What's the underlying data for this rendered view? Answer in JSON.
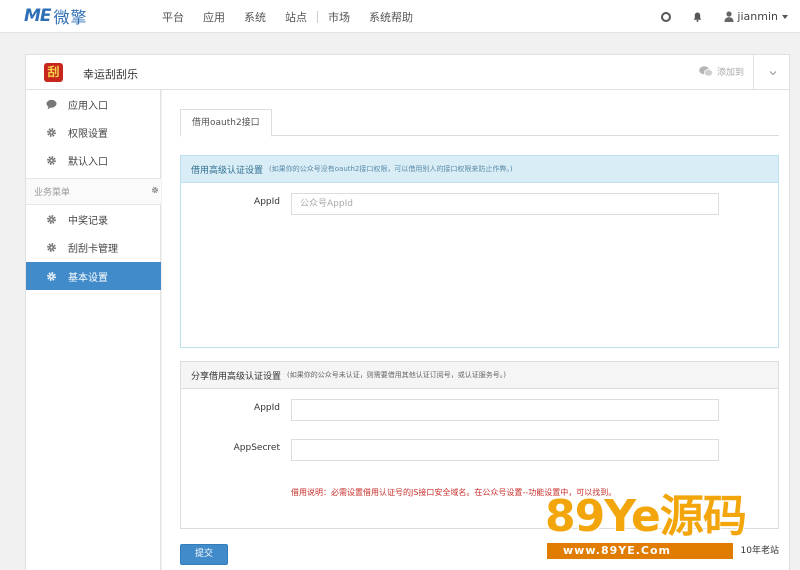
{
  "topbar": {
    "logo_mark": "ME",
    "logo_text": "微擎",
    "nav": [
      "平台",
      "应用",
      "系统",
      "站点",
      "市场",
      "系统帮助"
    ],
    "user": "jianmin"
  },
  "app": {
    "icon_char": "刮",
    "title": "幸运刮刮乐",
    "wechat_label": "添加到"
  },
  "sidebar": {
    "items": [
      {
        "label": "应用入口",
        "icon": "speech-bubble-icon"
      },
      {
        "label": "权限设置",
        "icon": "gear-icon"
      },
      {
        "label": "默认入口",
        "icon": "gear-icon"
      }
    ],
    "section_title": "业务菜单",
    "business_items": [
      {
        "label": "中奖记录",
        "icon": "gear-icon"
      },
      {
        "label": "刮刮卡管理",
        "icon": "gear-icon"
      },
      {
        "label": "基本设置",
        "icon": "gear-icon",
        "active": true
      }
    ]
  },
  "main": {
    "tab_label": "借用oauth2接口",
    "panel1": {
      "title": "借用高级认证设置",
      "hint": "(如果你的公众号没有oauth2接口权限，可以借用别人的接口权限来防止作弊。)",
      "appid_label": "AppId",
      "appid_placeholder": "公众号AppId"
    },
    "panel2": {
      "title": "分享借用高级认证设置",
      "hint": "(如果你的公众号未认证，则需要借用其他认证订阅号，或认证服务号。)",
      "appid_label": "AppId",
      "appid_value": "",
      "secret_label": "AppSecret",
      "secret_value": "",
      "help": "借用说明：必需设置借用认证号的JS接口安全域名。在公众号设置--功能设置中，可以找到。"
    },
    "submit_label": "提交"
  },
  "watermark": {
    "big": "89Ye源码",
    "bar": "www.89YE.Com",
    "tag": "10年老站"
  }
}
